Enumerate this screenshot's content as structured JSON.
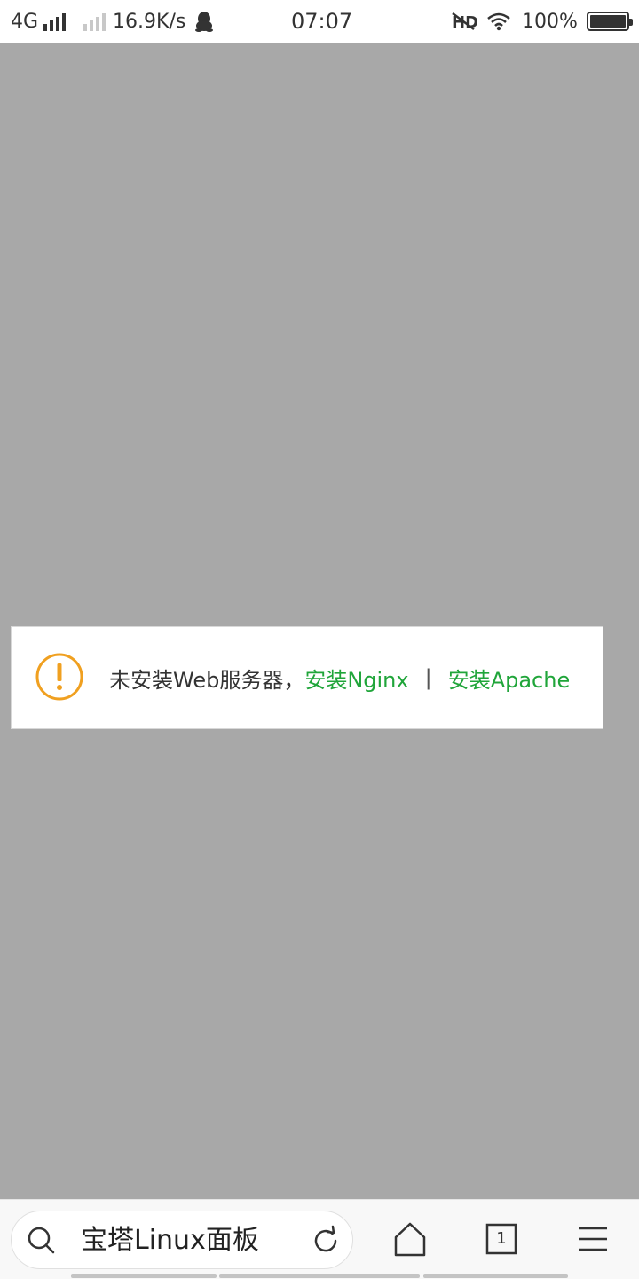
{
  "status_bar": {
    "network": "4G",
    "speed": "16.9K/s",
    "time": "07:07",
    "battery": "100%",
    "icons": [
      "signal-icon",
      "signal-weak-icon",
      "qq-icon",
      "hd-off-icon",
      "wifi-icon",
      "battery-icon"
    ]
  },
  "notice": {
    "message": "未安装Web服务器，",
    "link_nginx": "安装Nginx",
    "separator": "|",
    "link_apache": "安装Apache",
    "icon": "warning-icon",
    "accent_color": "#20a53a",
    "icon_color": "#f0a020"
  },
  "browser_bar": {
    "page_title": "宝塔Linux面板",
    "tab_count": "1",
    "icons": [
      "search-icon",
      "refresh-icon",
      "home-icon",
      "tabs-icon",
      "menu-icon"
    ]
  },
  "colors": {
    "overlay": "#a8a8a8",
    "link": "#20a53a"
  }
}
